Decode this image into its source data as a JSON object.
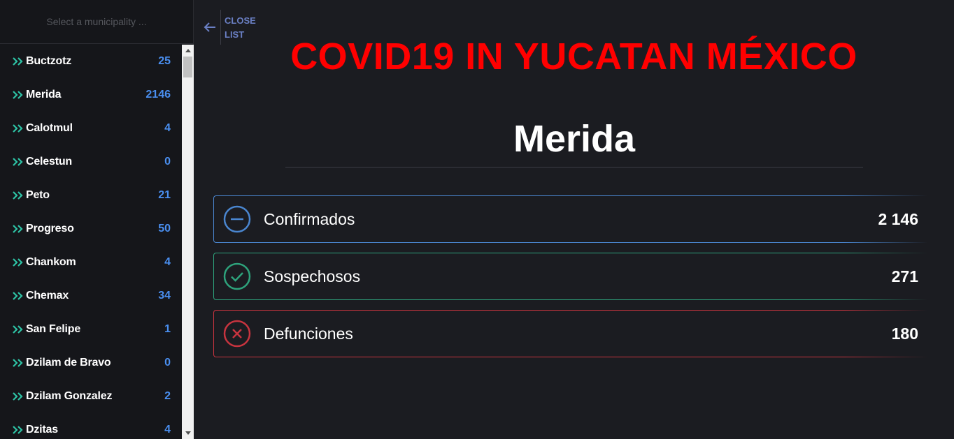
{
  "search": {
    "placeholder": "Select a municipality ..."
  },
  "sidebar": {
    "items": [
      {
        "name": "Buctzotz",
        "count": "25"
      },
      {
        "name": "Merida",
        "count": "2146"
      },
      {
        "name": "Calotmul",
        "count": "4"
      },
      {
        "name": "Celestun",
        "count": "0"
      },
      {
        "name": "Peto",
        "count": "21"
      },
      {
        "name": "Progreso",
        "count": "50"
      },
      {
        "name": "Chankom",
        "count": "4"
      },
      {
        "name": "Chemax",
        "count": "34"
      },
      {
        "name": "San Felipe",
        "count": "1"
      },
      {
        "name": "Dzilam de Bravo",
        "count": "0"
      },
      {
        "name": "Dzilam Gonzalez",
        "count": "2"
      },
      {
        "name": "Dzitas",
        "count": "4"
      }
    ]
  },
  "close_list": {
    "label": "CLOSE LIST"
  },
  "main": {
    "title": "COVID19 IN YUCATAN MÉXICO",
    "municipality": "Merida",
    "stats": {
      "confirmed": {
        "label": "Confirmados",
        "value": "2 146",
        "color": "#4a86d0"
      },
      "suspected": {
        "label": "Sospechosos",
        "value": "271",
        "color": "#2ea37c"
      },
      "deaths": {
        "label": "Defunciones",
        "value": "180",
        "color": "#c8343f"
      }
    }
  },
  "colors": {
    "background": "#1b1c21",
    "sidebar": "#15161a",
    "title": "#ff0000",
    "count": "#4a8ff0",
    "chevron": "#2ec4a6"
  },
  "icons": {
    "list_item": "double-chevron-right-icon",
    "close": "arrow-left-icon",
    "confirmed": "minus-circle-icon",
    "suspected": "check-circle-icon",
    "deaths": "x-circle-icon"
  }
}
